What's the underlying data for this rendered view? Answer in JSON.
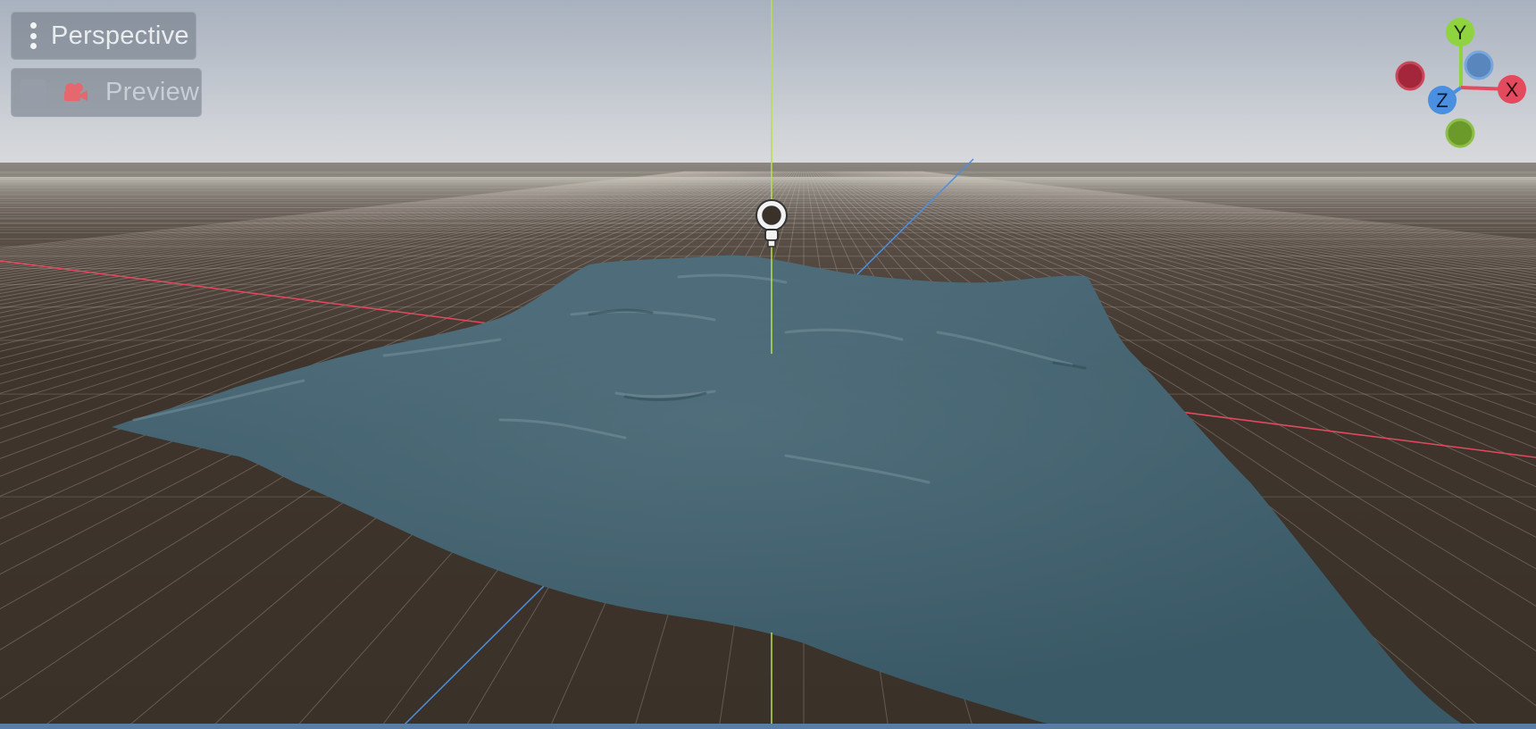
{
  "toolbar": {
    "view_menu_label": "Perspective",
    "preview_label": "Preview",
    "preview_checked": false
  },
  "view_gizmo": {
    "y_label": "Y",
    "x_label": "X",
    "z_label": "Z",
    "colors": {
      "x": "#e34a5e",
      "x_negative": "#a3263a",
      "y": "#8fd33e",
      "y_negative": "#6b9a2a",
      "z": "#4a8fe0",
      "z_negative": "#5a86be"
    }
  },
  "scene": {
    "sky_top": "#a8b1bf",
    "sky_horizon": "#d8d9db",
    "ground_color": "#3a3129",
    "water_color": "#3e5c68",
    "x_axis_color": "#e3495e",
    "y_axis_color": "#b8e04a",
    "z_axis_color": "#4b8ee3",
    "light_icon": "omni-light-icon"
  }
}
